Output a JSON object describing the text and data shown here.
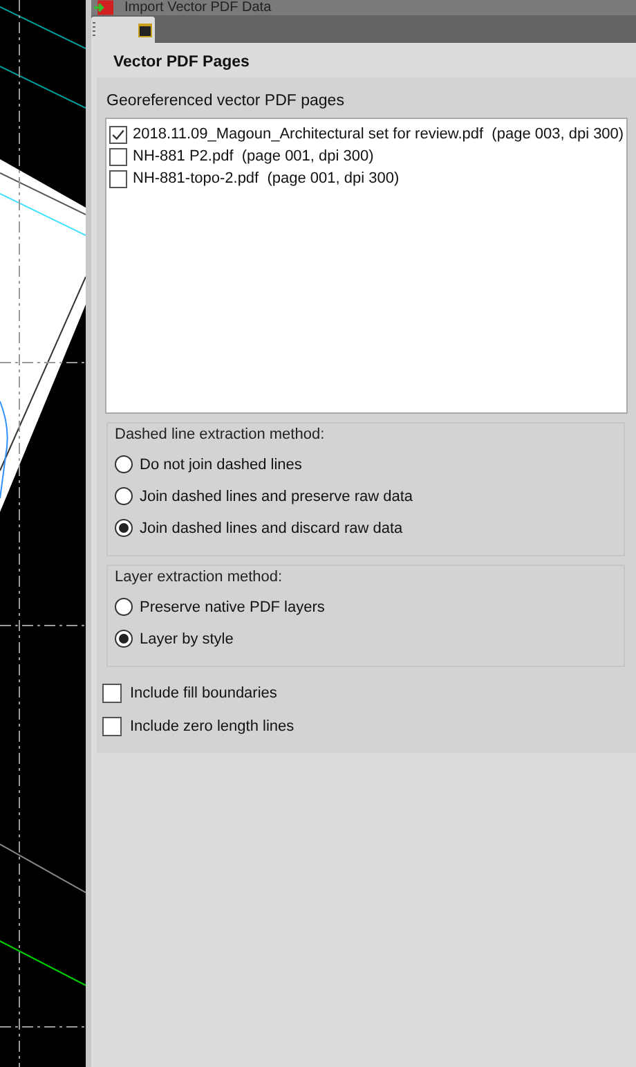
{
  "window": {
    "title": "Import Vector PDF Data"
  },
  "heading": "Vector PDF Pages",
  "pages": {
    "label": "Georeferenced vector PDF pages",
    "items": [
      {
        "text": "2018.11.09_Magoun_Architectural set for review.pdf  (page 003, dpi 300)",
        "checked": true
      },
      {
        "text": "NH-881 P2.pdf  (page 001, dpi 300)",
        "checked": false
      },
      {
        "text": "NH-881-topo-2.pdf  (page 001, dpi 300)",
        "checked": false
      }
    ]
  },
  "dashed": {
    "label": "Dashed line extraction method:",
    "options": [
      {
        "label": "Do not join dashed lines",
        "selected": false
      },
      {
        "label": "Join dashed lines and preserve raw data",
        "selected": false
      },
      {
        "label": "Join dashed lines and discard raw data",
        "selected": true
      }
    ]
  },
  "layer": {
    "label": "Layer extraction method:",
    "options": [
      {
        "label": "Preserve native PDF layers",
        "selected": false
      },
      {
        "label": "Layer by style",
        "selected": true
      }
    ]
  },
  "options": [
    {
      "label": "Include fill boundaries",
      "checked": false
    },
    {
      "label": "Include zero length lines",
      "checked": false
    }
  ]
}
